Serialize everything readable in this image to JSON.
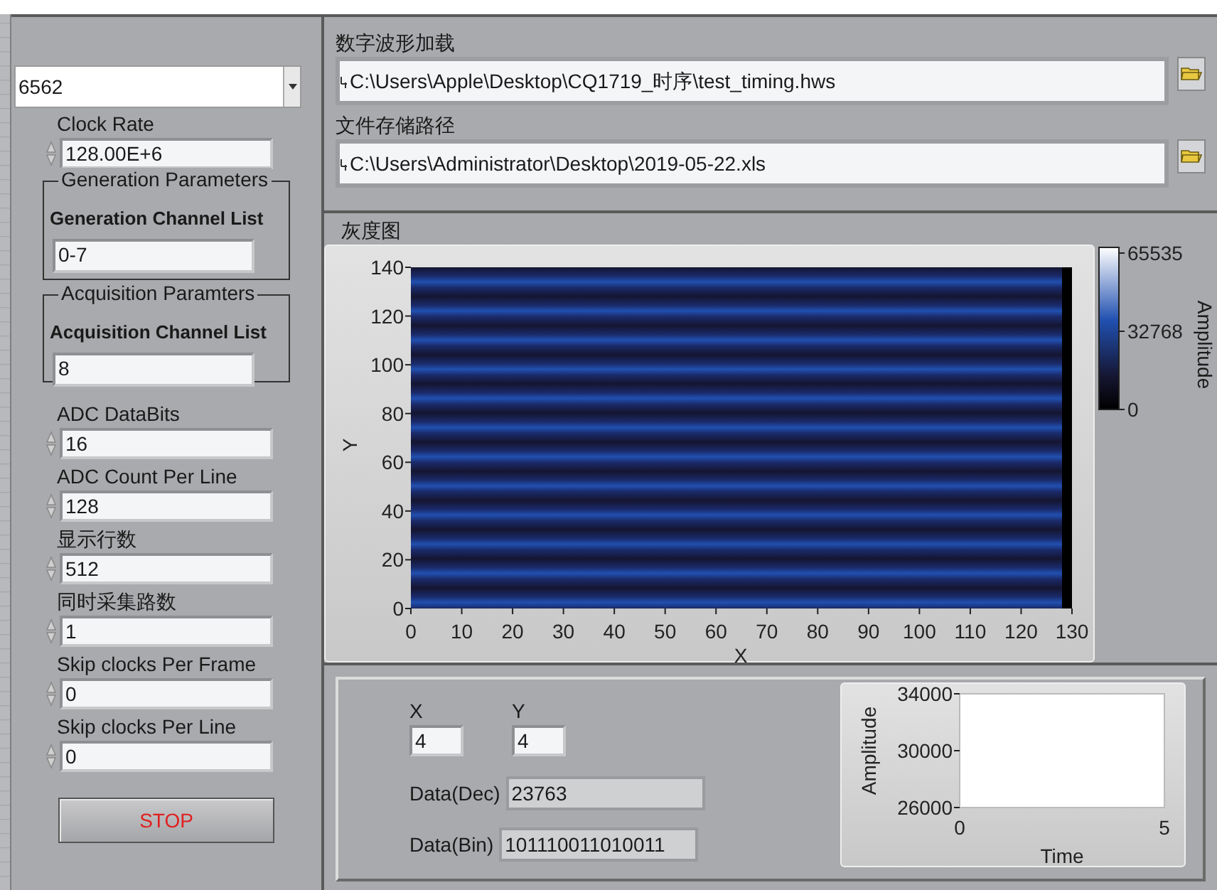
{
  "left_panel": {
    "device_combo": {
      "value": "6562"
    },
    "clock_rate": {
      "label": "Clock Rate",
      "value": "128.00E+6"
    },
    "generation": {
      "title": "Generation Parameters",
      "label": "Generation Channel  List",
      "value": "0-7"
    },
    "acquisition": {
      "title": "Acquisition Paramters",
      "label": "Acquisition Channel  List",
      "value": "8"
    },
    "numeric_fields": [
      {
        "label": "ADC DataBits",
        "value": "16"
      },
      {
        "label": "ADC Count Per Line",
        "value": "128"
      },
      {
        "label": "显示行数",
        "value": "512"
      },
      {
        "label": "同时采集路数",
        "value": "1"
      },
      {
        "label": "Skip clocks Per Frame",
        "value": "0"
      },
      {
        "label": "Skip clocks Per Line",
        "value": "0"
      }
    ],
    "stop_button": "STOP"
  },
  "paths": [
    {
      "label": "数字波形加载",
      "value": "C:\\Users\\Apple\\Desktop\\CQ1719_时序\\test_timing.hws"
    },
    {
      "label": "文件存储路径",
      "value": "C:\\Users\\Administrator\\Desktop\\2019-05-22.xls"
    }
  ],
  "intensity_graph": {
    "title": "灰度图",
    "xlabel": "X",
    "ylabel": "Y",
    "xticks": [
      "0",
      "10",
      "20",
      "30",
      "40",
      "50",
      "60",
      "70",
      "80",
      "90",
      "100",
      "110",
      "120",
      "130"
    ],
    "yticks": [
      "140",
      "120",
      "100",
      "80",
      "60",
      "40",
      "20",
      "0"
    ],
    "scale": {
      "label": "Amplitude",
      "ticks": [
        "65535",
        "32768",
        "0"
      ]
    }
  },
  "cursor": {
    "x": {
      "label": "X",
      "value": "4"
    },
    "y": {
      "label": "Y",
      "value": "4"
    },
    "data_dec": {
      "label": "Data(Dec)",
      "value": "23763"
    },
    "data_bin": {
      "label": "Data(Bin)",
      "value": "101110011010011"
    }
  },
  "waveform_chart": {
    "xlabel": "Time",
    "ylabel": "Amplitude",
    "yticks": [
      "34000",
      "30000",
      "26000"
    ],
    "xticks": [
      "0",
      "5"
    ]
  }
}
